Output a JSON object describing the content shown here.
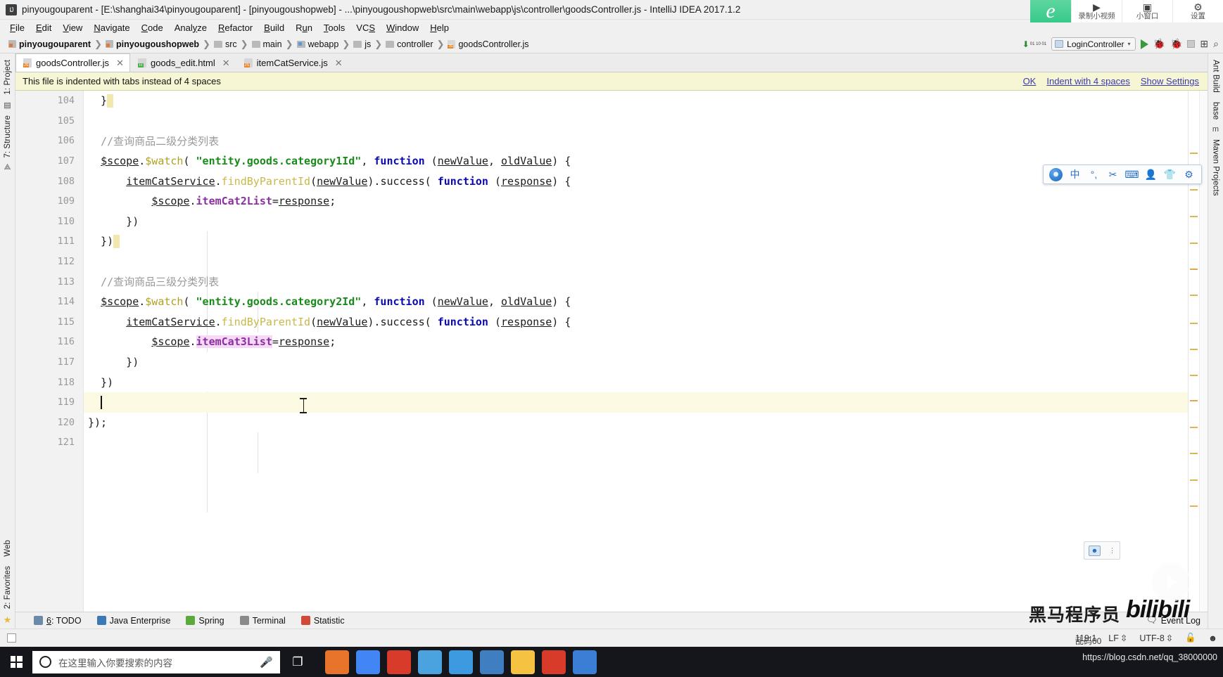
{
  "window": {
    "title": "pinyougouparent - [E:\\shanghai34\\pinyougouparent] - [pinyougoushopweb] - ...\\pinyougoushopweb\\src\\main\\webapp\\js\\controller\\goodsController.js - IntelliJ IDEA 2017.1.2",
    "app_icon": "IJ"
  },
  "recorder": {
    "logo": "e",
    "items": [
      {
        "icon": "▶",
        "label": "录制小视频"
      },
      {
        "icon": "▣",
        "label": "小窗口"
      },
      {
        "icon": "⚙",
        "label": "设置"
      }
    ]
  },
  "menu": [
    {
      "label": "File",
      "mnemonic": "F"
    },
    {
      "label": "Edit",
      "mnemonic": "E"
    },
    {
      "label": "View",
      "mnemonic": "V"
    },
    {
      "label": "Navigate",
      "mnemonic": "N"
    },
    {
      "label": "Code",
      "mnemonic": "C"
    },
    {
      "label": "Analyze",
      "mnemonic": "y"
    },
    {
      "label": "Refactor",
      "mnemonic": "R"
    },
    {
      "label": "Build",
      "mnemonic": "B"
    },
    {
      "label": "Run",
      "mnemonic": "u"
    },
    {
      "label": "Tools",
      "mnemonic": "T"
    },
    {
      "label": "VCS",
      "mnemonic": "S"
    },
    {
      "label": "Window",
      "mnemonic": "W"
    },
    {
      "label": "Help",
      "mnemonic": "H"
    }
  ],
  "breadcrumb": [
    {
      "label": "pinyougouparent",
      "icon": "module-icon",
      "bold": true
    },
    {
      "label": "pinyougoushopweb",
      "icon": "module-icon",
      "bold": true
    },
    {
      "label": "src",
      "icon": "folder-icon",
      "bold": false
    },
    {
      "label": "main",
      "icon": "folder-icon",
      "bold": false
    },
    {
      "label": "webapp",
      "icon": "folder-web-icon",
      "bold": false
    },
    {
      "label": "js",
      "icon": "folder-icon",
      "bold": false
    },
    {
      "label": "controller",
      "icon": "folder-icon",
      "bold": false
    },
    {
      "label": "goodsController.js",
      "icon": "js-file-icon",
      "bold": false
    }
  ],
  "toolbar_right": {
    "run_config": "LoginController",
    "run_config_arrow": "▾",
    "download_icon": "⬇",
    "bits": "01 10 01",
    "run_icon": "run-icon",
    "debug_icon": "debug-icon",
    "coverage_icon": "coverage-icon",
    "stop_icon": "stop-icon",
    "layout_icon": "⊞",
    "search_icon": "🔍"
  },
  "tabs": [
    {
      "label": "goodsController.js",
      "type": "js",
      "active": true,
      "close": "✕"
    },
    {
      "label": "goods_edit.html",
      "type": "html",
      "active": false,
      "close": "✕"
    },
    {
      "label": "itemCatService.js",
      "type": "js",
      "active": false,
      "close": "✕"
    }
  ],
  "notification": {
    "message": "This file is indented with tabs instead of 4 spaces",
    "links": [
      "OK",
      "Indent with 4 spaces",
      "Show Settings"
    ]
  },
  "left_strip": {
    "top": [
      "1: Project",
      "7: Structure"
    ],
    "bottom": [
      "Web",
      "2: Favorites"
    ]
  },
  "right_strip": {
    "top": [
      "Ant Build",
      "base",
      "Maven Projects"
    ]
  },
  "editor": {
    "line_numbers": [
      "104",
      "105",
      "106",
      "107",
      "108",
      "109",
      "110",
      "111",
      "112",
      "113",
      "114",
      "115",
      "116",
      "117",
      "118",
      "119",
      "120",
      "121"
    ],
    "current_line": "119",
    "lines": [
      {
        "num": "104",
        "fold": "minus",
        "tokens": [
          {
            "t": "  }",
            "c": "t-punc"
          },
          {
            "t": "SEL",
            "c": "sel"
          }
        ]
      },
      {
        "num": "105",
        "fold": "",
        "tokens": []
      },
      {
        "num": "106",
        "fold": "",
        "tokens": [
          {
            "t": "  //查询商品二级分类列表",
            "c": "t-cmt"
          }
        ]
      },
      {
        "num": "107",
        "fold": "minus",
        "tokens": [
          {
            "t": "  ",
            "c": "t-plain"
          },
          {
            "t": "$scope",
            "c": "t-id"
          },
          {
            "t": ".",
            "c": "t-punc"
          },
          {
            "t": "$watch",
            "c": "t-fn"
          },
          {
            "t": "( ",
            "c": "t-punc"
          },
          {
            "t": "\"entity.goods.category1Id\"",
            "c": "t-str"
          },
          {
            "t": ", ",
            "c": "t-punc"
          },
          {
            "t": "function",
            "c": "t-kw"
          },
          {
            "t": " (",
            "c": "t-punc"
          },
          {
            "t": "newValue",
            "c": "t-id"
          },
          {
            "t": ", ",
            "c": "t-punc"
          },
          {
            "t": "oldValue",
            "c": "t-id"
          },
          {
            "t": ") {",
            "c": "t-punc"
          }
        ]
      },
      {
        "num": "108",
        "fold": "minus",
        "tokens": [
          {
            "t": "      ",
            "c": "t-plain"
          },
          {
            "t": "itemCatService",
            "c": "t-id"
          },
          {
            "t": ".",
            "c": "t-punc"
          },
          {
            "t": "findByParentId",
            "c": "t-fn2"
          },
          {
            "t": "(",
            "c": "t-punc"
          },
          {
            "t": "newValue",
            "c": "t-id"
          },
          {
            "t": ").",
            "c": "t-punc"
          },
          {
            "t": "success",
            "c": "t-plain"
          },
          {
            "t": "( ",
            "c": "t-punc"
          },
          {
            "t": "function",
            "c": "t-kw"
          },
          {
            "t": " (",
            "c": "t-punc"
          },
          {
            "t": "response",
            "c": "t-id"
          },
          {
            "t": ") {",
            "c": "t-punc"
          }
        ]
      },
      {
        "num": "109",
        "fold": "",
        "tokens": [
          {
            "t": "          ",
            "c": "t-plain"
          },
          {
            "t": "$scope",
            "c": "t-id"
          },
          {
            "t": ".",
            "c": "t-punc"
          },
          {
            "t": "itemCat2List",
            "c": "t-fld"
          },
          {
            "t": "=",
            "c": "t-punc"
          },
          {
            "t": "response",
            "c": "t-id"
          },
          {
            "t": ";",
            "c": "t-punc"
          }
        ]
      },
      {
        "num": "110",
        "fold": "minus",
        "tokens": [
          {
            "t": "      })",
            "c": "t-punc"
          }
        ]
      },
      {
        "num": "111",
        "fold": "minus",
        "tokens": [
          {
            "t": "  })",
            "c": "t-punc"
          },
          {
            "t": "SEL",
            "c": "sel"
          }
        ]
      },
      {
        "num": "112",
        "fold": "",
        "tokens": []
      },
      {
        "num": "113",
        "fold": "",
        "tokens": [
          {
            "t": "  //查询商品三级分类列表",
            "c": "t-cmt"
          }
        ]
      },
      {
        "num": "114",
        "fold": "minus",
        "tokens": [
          {
            "t": "  ",
            "c": "t-plain"
          },
          {
            "t": "$scope",
            "c": "t-id"
          },
          {
            "t": ".",
            "c": "t-punc"
          },
          {
            "t": "$watch",
            "c": "t-fn"
          },
          {
            "t": "( ",
            "c": "t-punc"
          },
          {
            "t": "\"entity.goods.category2Id\"",
            "c": "t-str"
          },
          {
            "t": ", ",
            "c": "t-punc"
          },
          {
            "t": "function",
            "c": "t-kw"
          },
          {
            "t": " (",
            "c": "t-punc"
          },
          {
            "t": "newValue",
            "c": "t-id"
          },
          {
            "t": ", ",
            "c": "t-punc"
          },
          {
            "t": "oldValue",
            "c": "t-id"
          },
          {
            "t": ") {",
            "c": "t-punc"
          }
        ]
      },
      {
        "num": "115",
        "fold": "minus",
        "tokens": [
          {
            "t": "      ",
            "c": "t-plain"
          },
          {
            "t": "itemCatService",
            "c": "t-id"
          },
          {
            "t": ".",
            "c": "t-punc"
          },
          {
            "t": "findByParentId",
            "c": "t-fn2"
          },
          {
            "t": "(",
            "c": "t-punc"
          },
          {
            "t": "newValue",
            "c": "t-id"
          },
          {
            "t": ").",
            "c": "t-punc"
          },
          {
            "t": "success",
            "c": "t-plain"
          },
          {
            "t": "( ",
            "c": "t-punc"
          },
          {
            "t": "function",
            "c": "t-kw"
          },
          {
            "t": " (",
            "c": "t-punc"
          },
          {
            "t": "response",
            "c": "t-id"
          },
          {
            "t": ") {",
            "c": "t-punc"
          }
        ]
      },
      {
        "num": "116",
        "fold": "",
        "tokens": [
          {
            "t": "          ",
            "c": "t-plain"
          },
          {
            "t": "$scope",
            "c": "t-id"
          },
          {
            "t": ".",
            "c": "t-punc"
          },
          {
            "t": "itemCat3List",
            "c": "t-fld pinkbg"
          },
          {
            "t": "=",
            "c": "t-punc"
          },
          {
            "t": "response",
            "c": "t-id"
          },
          {
            "t": ";",
            "c": "t-punc"
          }
        ]
      },
      {
        "num": "117",
        "fold": "minus",
        "tokens": [
          {
            "t": "      })",
            "c": "t-punc"
          }
        ]
      },
      {
        "num": "118",
        "fold": "minus",
        "tokens": [
          {
            "t": "  })",
            "c": "t-punc"
          }
        ]
      },
      {
        "num": "119",
        "fold": "",
        "highlight": true,
        "tokens": [
          {
            "t": "  ",
            "c": "t-plain"
          },
          {
            "t": "CARET",
            "c": "caret"
          }
        ]
      },
      {
        "num": "120",
        "fold": "minus",
        "tokens": [
          {
            "t": "});",
            "c": "t-punc"
          }
        ]
      },
      {
        "num": "121",
        "fold": "",
        "tokens": []
      }
    ]
  },
  "bottom_tools": [
    {
      "label": "6: TODO",
      "mnemonic": "6",
      "icon": "todo-icon",
      "color": "#6a8aa8"
    },
    {
      "label": "Java Enterprise",
      "icon": "java-ee-icon",
      "color": "#3c78b4"
    },
    {
      "label": "Spring",
      "icon": "spring-icon",
      "color": "#5caa3c"
    },
    {
      "label": "Terminal",
      "icon": "terminal-icon",
      "color": "#8a8a8a"
    },
    {
      "label": "Statistic",
      "icon": "statistic-icon",
      "color": "#d04a3a"
    }
  ],
  "event_log": {
    "label": "Event Log",
    "icon": "speech-bubble-icon"
  },
  "status": {
    "position": "119:1",
    "line_separator": "LF",
    "encoding": "UTF-8",
    "lock_icon": "🔒",
    "inspection_icon": "inspector-icon"
  },
  "taskbar": {
    "start": "windows-logo",
    "search_placeholder": "在这里输入你要搜索的内容",
    "mic_icon": "🎤",
    "taskview_icon": "▢",
    "apps": [
      {
        "name": "firefox-icon",
        "color": "#e8732a"
      },
      {
        "name": "chrome-icon",
        "color": "#4285f4"
      },
      {
        "name": "recorder-icon",
        "color": "#d93b2b"
      },
      {
        "name": "editor-icon",
        "color": "#4aa3df"
      },
      {
        "name": "app-icon",
        "color": "#3d9ae0"
      },
      {
        "name": "intellij-icon",
        "color": "#3f7fc1"
      },
      {
        "name": "explorer-icon",
        "color": "#f5c242"
      },
      {
        "name": "pdf-icon",
        "color": "#d93b2b"
      },
      {
        "name": "tool-icon",
        "color": "#3a7fd5"
      }
    ]
  },
  "ime_toolbar": {
    "items": [
      "logo",
      "中",
      "°,",
      "✂",
      "⌨",
      "👤",
      "👕",
      "⚙"
    ]
  },
  "watermarks": {
    "heima": "黑马程序员",
    "bili": "bilibili",
    "url": "https://blog.csdn.net/qq_38000000",
    "small": "乱码00"
  }
}
